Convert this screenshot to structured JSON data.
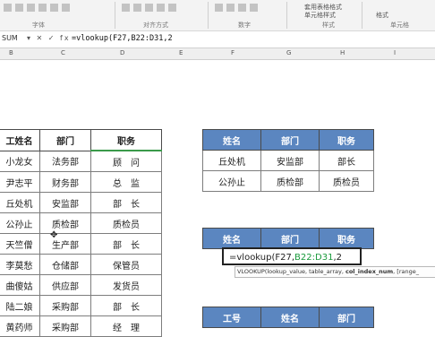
{
  "ribbon": {
    "group_font": "字体",
    "group_align": "对齐方式",
    "group_number": "数字",
    "group_styles": "样式",
    "group_cells": "单元格",
    "style_item1": "套用表格格式",
    "style_item2": "单元格样式",
    "cells_item1": "格式"
  },
  "formula_bar": {
    "name_box": "SUM",
    "icons": "▾ ✕ ✓ fx",
    "content": "=vlookup(F27,B22:D31,2"
  },
  "columns": [
    "B",
    "C",
    "D",
    "E",
    "F",
    "G",
    "H",
    "I"
  ],
  "table_left": {
    "headers": [
      "工姓名",
      "部门",
      "职务"
    ],
    "rows": [
      [
        "小龙女",
        "法务部",
        "顾　问"
      ],
      [
        "尹志平",
        "财务部",
        "总　监"
      ],
      [
        "丘处机",
        "安监部",
        "部　长"
      ],
      [
        "公孙止",
        "质检部",
        "质检员"
      ],
      [
        "天竺僧",
        "生产部",
        "部　长"
      ],
      [
        "李莫愁",
        "仓储部",
        "保管员"
      ],
      [
        "曲傻姑",
        "供应部",
        "发货员"
      ],
      [
        "陆二娘",
        "采购部",
        "部　长"
      ],
      [
        "黄药师",
        "采购部",
        "经　理"
      ]
    ]
  },
  "table_right_top": {
    "headers": [
      "姓名",
      "部门",
      "职务"
    ],
    "rows": [
      [
        "丘处机",
        "安监部",
        "部长"
      ],
      [
        "公孙止",
        "质检部",
        "质检员"
      ]
    ]
  },
  "table_right_mid": {
    "headers": [
      "姓名",
      "部门",
      "职务"
    ],
    "editing_text_prefix": "=vlookup(F27,",
    "editing_text_range": "B22:D31",
    "editing_text_suffix": ",2"
  },
  "tooltip": {
    "func": "VLOOKUP(",
    "args": "lookup_value, table_array, ",
    "bold_arg": "col_index_num",
    "rest": ", [range_"
  },
  "table_right_bottom": {
    "headers": [
      "工号",
      "姓名",
      "部门"
    ]
  }
}
